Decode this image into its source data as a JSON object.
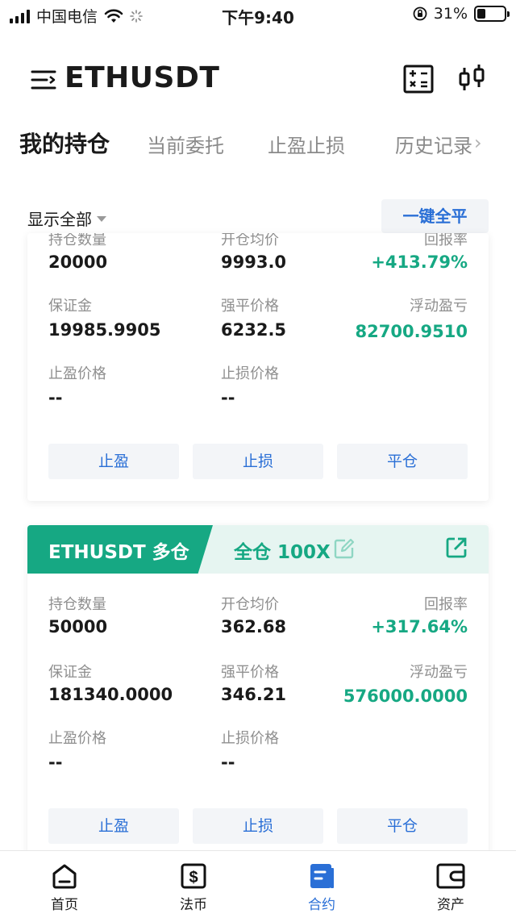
{
  "status_bar": {
    "carrier": "中国电信",
    "time": "下午9:40",
    "battery_percent": "31%",
    "battery_level": 0.31
  },
  "header": {
    "title": "ETHUSDT"
  },
  "tabs": [
    {
      "label": "我的持仓",
      "active": true
    },
    {
      "label": "当前委托",
      "active": false
    },
    {
      "label": "止盈止损",
      "active": false
    },
    {
      "label": "历史记录",
      "active": false
    }
  ],
  "filter": {
    "label": "显示全部",
    "close_all_label": "一键全平"
  },
  "positions": [
    {
      "qty_label": "持仓数量",
      "qty": "20000",
      "entry_label": "开仓均价",
      "entry": "9993.0",
      "roe_label": "回报率",
      "roe": "+413.79%",
      "margin_label": "保证金",
      "margin": "19985.9905",
      "liq_label": "强平价格",
      "liq": "6232.5",
      "pnl_label": "浮动盈亏",
      "pnl": "82700.9510",
      "tp_label": "止盈价格",
      "tp": "--",
      "sl_label": "止损价格",
      "sl": "--",
      "btn_tp": "止盈",
      "btn_sl": "止损",
      "btn_close": "平仓"
    },
    {
      "symbol": "ETHUSDT 多仓",
      "mode": "全仓 100X",
      "qty_label": "持仓数量",
      "qty": "50000",
      "entry_label": "开仓均价",
      "entry": "362.68",
      "roe_label": "回报率",
      "roe": "+317.64%",
      "margin_label": "保证金",
      "margin": "181340.0000",
      "liq_label": "强平价格",
      "liq": "346.21",
      "pnl_label": "浮动盈亏",
      "pnl": "576000.0000",
      "tp_label": "止盈价格",
      "tp": "--",
      "sl_label": "止损价格",
      "sl": "--",
      "btn_tp": "止盈",
      "btn_sl": "止损",
      "btn_close": "平仓"
    }
  ],
  "bottom_nav": [
    {
      "label": "首页",
      "icon": "home-icon",
      "active": false
    },
    {
      "label": "法币",
      "icon": "fiat-icon",
      "active": false
    },
    {
      "label": "合约",
      "icon": "contract-icon",
      "active": true
    },
    {
      "label": "资产",
      "icon": "wallet-icon",
      "active": false
    }
  ],
  "colors": {
    "accent_green": "#16a883",
    "link_blue": "#2a6fd6"
  }
}
